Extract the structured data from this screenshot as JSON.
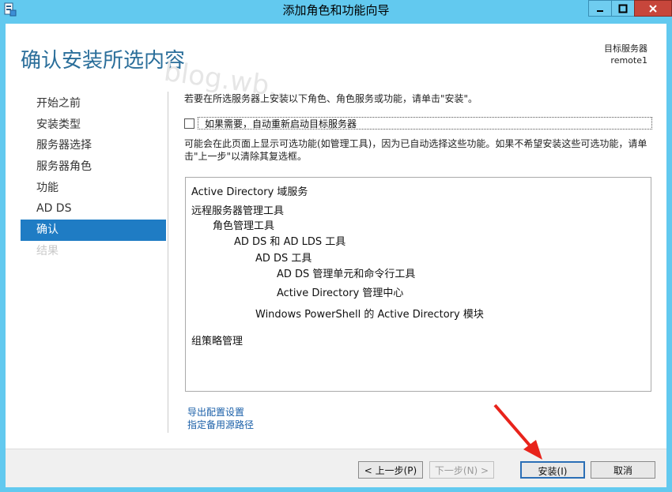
{
  "window": {
    "title": "添加角色和功能向导"
  },
  "header": {
    "page_title": "确认安装所选内容",
    "target_label": "目标服务器",
    "target_name": "remote1",
    "watermark": "blog.wb..."
  },
  "nav": {
    "items": [
      {
        "label": "开始之前",
        "state": "normal"
      },
      {
        "label": "安装类型",
        "state": "normal"
      },
      {
        "label": "服务器选择",
        "state": "normal"
      },
      {
        "label": "服务器角色",
        "state": "normal"
      },
      {
        "label": "功能",
        "state": "normal"
      },
      {
        "label": "AD DS",
        "state": "normal"
      },
      {
        "label": "确认",
        "state": "active"
      },
      {
        "label": "结果",
        "state": "disabled"
      }
    ]
  },
  "content": {
    "intro": "若要在所选服务器上安装以下角色、角色服务或功能，请单击\"安装\"。",
    "restart_label": "如果需要，自动重新启动目标服务器",
    "optional_note": "可能会在此页面上显示可选功能(如管理工具)，因为已自动选择这些功能。如果不希望安装这些可选功能，请单击\"上一步\"以清除其复选框。",
    "selection": [
      "Active Directory 域服务",
      "远程服务器管理工具",
      "角色管理工具",
      "AD DS 和 AD LDS 工具",
      "AD DS 工具",
      "AD DS 管理单元和命令行工具",
      "Active Directory 管理中心",
      "Windows PowerShell 的 Active Directory 模块",
      "组策略管理"
    ],
    "export_link": "导出配置设置",
    "alt_source_link": "指定备用源路径"
  },
  "footer": {
    "prev_label": "< 上一步(P)",
    "next_label": "下一步(N) >",
    "install_label": "安装(I)",
    "cancel_label": "取消"
  },
  "colors": {
    "frame": "#62c9ef",
    "accent": "#1f7cc4",
    "title": "#2a6e9a",
    "link": "#1a5fa8",
    "arrow": "#e8231b"
  }
}
